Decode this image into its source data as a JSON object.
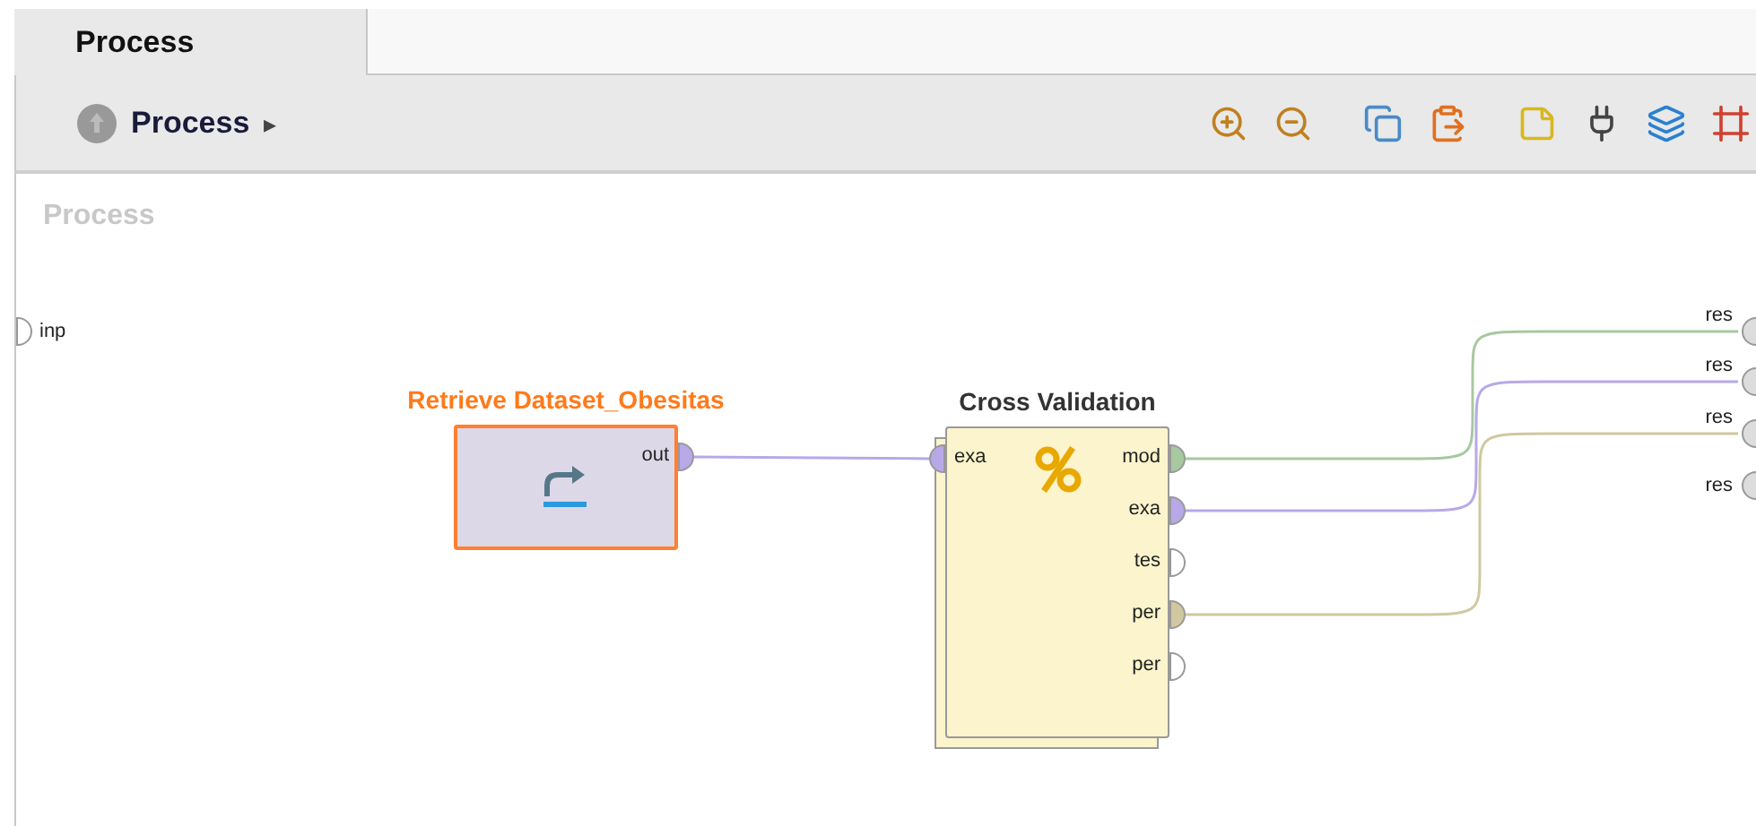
{
  "tabs": [
    {
      "label": "Process",
      "selected": true
    }
  ],
  "breadcrumb": {
    "label": "Process",
    "arrow": "▸"
  },
  "canvas": {
    "title": "Process",
    "inputs": [
      {
        "label": "inp"
      }
    ],
    "nodes": [
      {
        "kind": "retrieve",
        "title": "Retrieve Dataset_Obesitas",
        "selected": true,
        "outputs": [
          {
            "label": "out",
            "color": "#b8a8e8"
          }
        ]
      },
      {
        "kind": "validation",
        "title": "Cross Validation",
        "selected": false,
        "inputs": [
          {
            "label": "exa",
            "color": "#b8a8e8"
          }
        ],
        "outputs": [
          {
            "label": "mod",
            "color": "#a8c8a0"
          },
          {
            "label": "exa",
            "color": "#b8a8e8"
          },
          {
            "label": "tes"
          },
          {
            "label": "per",
            "color": "#d0c8a0"
          },
          {
            "label": "per"
          }
        ]
      }
    ],
    "results": [
      {
        "label": "res"
      },
      {
        "label": "res"
      },
      {
        "label": "res"
      },
      {
        "label": "res"
      }
    ]
  }
}
